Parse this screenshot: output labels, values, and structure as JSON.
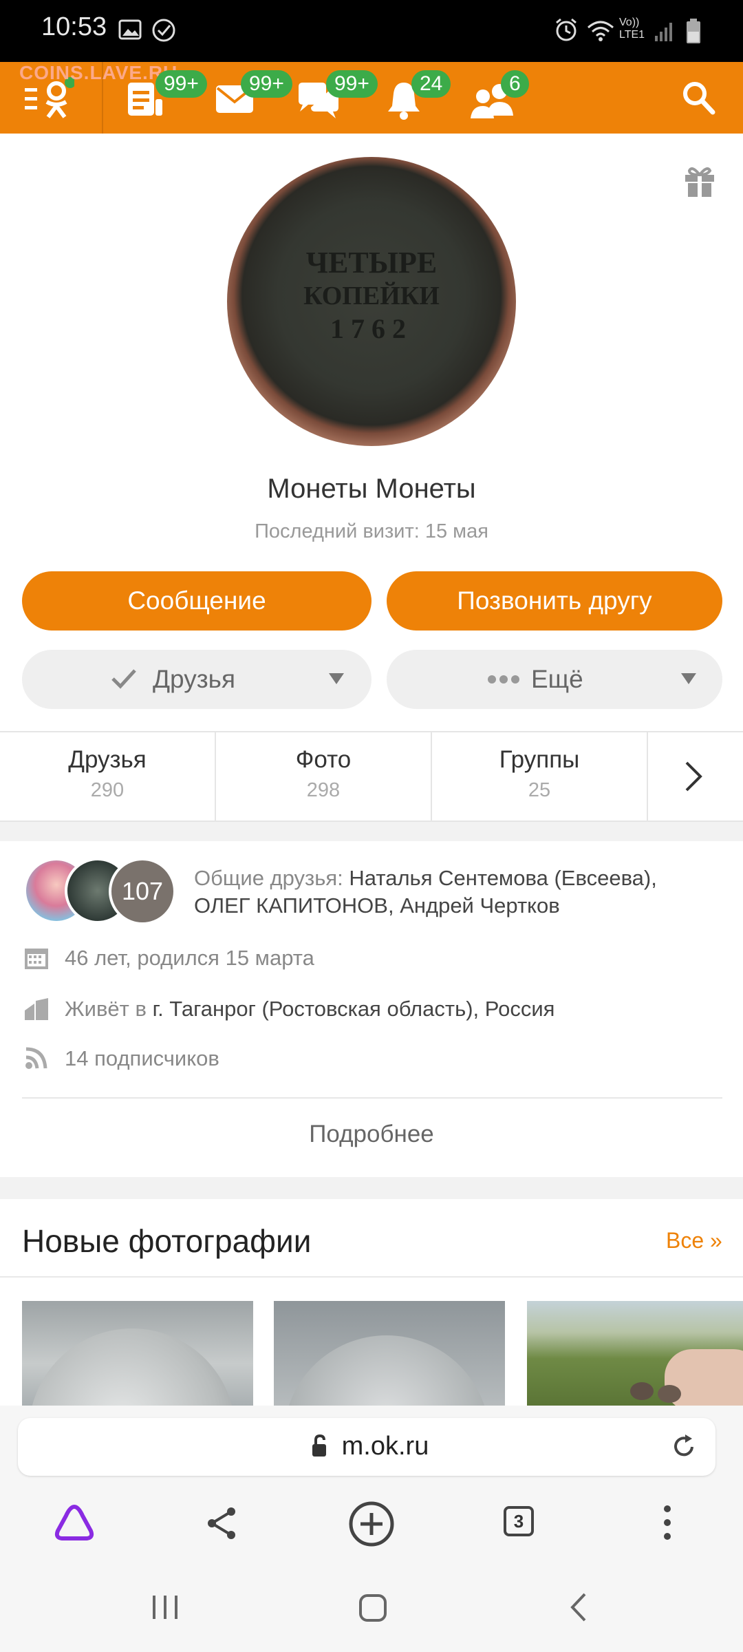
{
  "status": {
    "time": "10:53",
    "network": "Vo)) LTE1",
    "icons": [
      "image-icon",
      "check-circle-icon",
      "alarm-icon",
      "wifi-icon",
      "signal-icon",
      "battery-icon"
    ]
  },
  "topnav": {
    "watermark": "COINS.LAVE.RU",
    "badges": {
      "feed": "99+",
      "messages": "99+",
      "discussions": "99+",
      "notifications": "24",
      "friends": "6"
    },
    "colors": {
      "accent": "#ee8208",
      "badge": "#3cab49"
    }
  },
  "profile": {
    "coin_lines": [
      "ЧЕТЫРЕ",
      "КОПЕЙКИ",
      "1762"
    ],
    "name": "Монеты Монеты",
    "last_visit": "Последний визит: 15 мая",
    "buttons": {
      "message": "Сообщение",
      "call": "Позвонить другу",
      "friends": "Друзья",
      "more": "Ещё"
    }
  },
  "stats": [
    {
      "label": "Друзья",
      "count": "290"
    },
    {
      "label": "Фото",
      "count": "298"
    },
    {
      "label": "Группы",
      "count": "25"
    }
  ],
  "info": {
    "mutual_count": "107",
    "mutual_label": "Общие друзья:",
    "mutual_names_1": "Наталья Сентемова (Евсеева),",
    "mutual_names_2": "ОЛЕГ КАПИТОНОВ, Андрей Чертков",
    "age": "46 лет, родился 15 марта",
    "lives_label": "Живёт в",
    "lives_place": "г. Таганрог (Ростовская область), Россия",
    "subscribers": "14 подписчиков",
    "more": "Подробнее"
  },
  "photos": {
    "title": "Новые фотографии",
    "all": "Все »"
  },
  "browser": {
    "url": "m.ok.ru",
    "tabs_count": "3"
  }
}
